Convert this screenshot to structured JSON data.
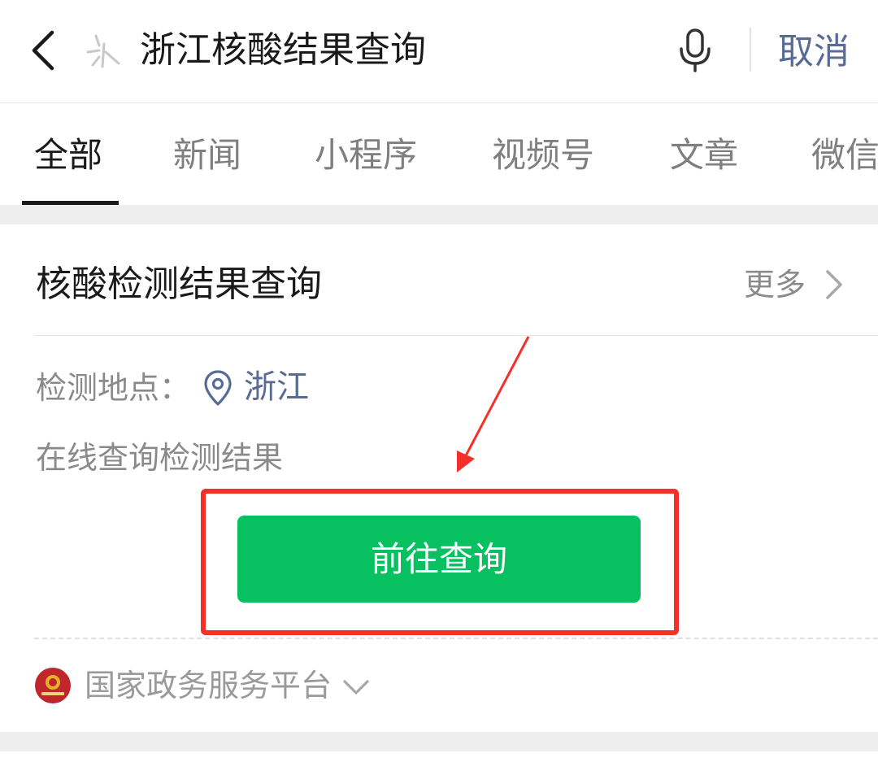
{
  "search": {
    "query": "浙江核酸结果查询",
    "cancel_label": "取消"
  },
  "tabs": [
    {
      "label": "全部",
      "active": true
    },
    {
      "label": "新闻",
      "active": false
    },
    {
      "label": "小程序",
      "active": false
    },
    {
      "label": "视频号",
      "active": false
    },
    {
      "label": "文章",
      "active": false
    },
    {
      "label": "微信",
      "active": false
    }
  ],
  "card": {
    "title": "核酸检测结果查询",
    "more_label": "更多",
    "location_label": "检测地点：",
    "location_value": "浙江",
    "description": "在线查询检测结果",
    "action_button": "前往查询",
    "source": "国家政务服务平台"
  },
  "colors": {
    "accent_green": "#07c160",
    "link_blue": "#576b95",
    "highlight_red": "#f5302a"
  },
  "icons": [
    "back-arrow-icon",
    "wechat-search-logo-icon",
    "microphone-icon",
    "chevron-right-icon",
    "location-pin-icon",
    "national-emblem-icon",
    "chevron-down-icon"
  ]
}
